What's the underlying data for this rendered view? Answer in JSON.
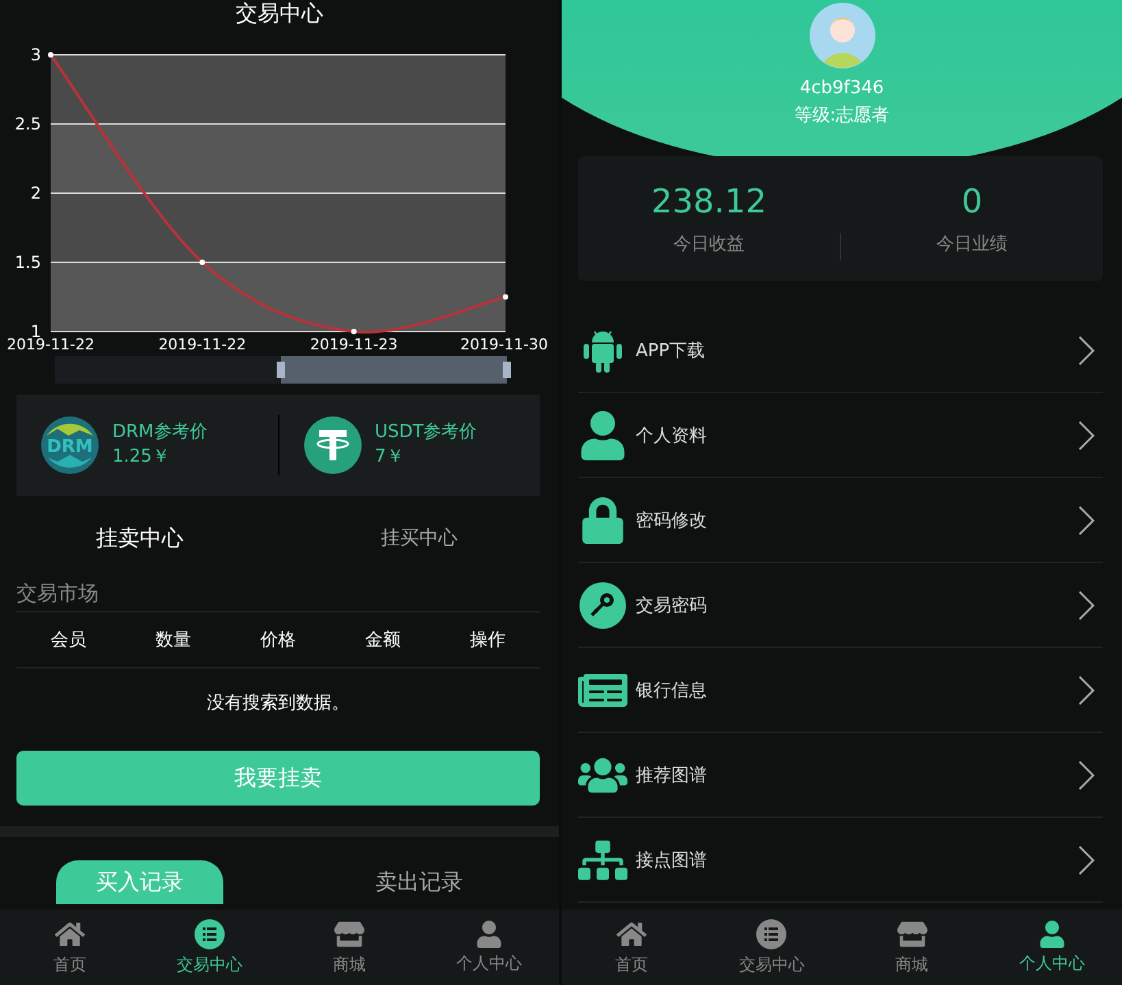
{
  "left": {
    "title": "交易中心",
    "chart_data": {
      "type": "line",
      "categories": [
        "2019-11-22",
        "2019-11-22",
        "2019-11-23",
        "2019-11-30"
      ],
      "grid": true,
      "series": [
        {
          "color": "#b8323a",
          "marker": true,
          "values": [
            3,
            1.5,
            1,
            1.25
          ]
        }
      ],
      "ylim": [
        1,
        3
      ],
      "yticks": [
        {
          "value": 1,
          "label": "1"
        },
        {
          "value": 1.5,
          "label": "1.5"
        },
        {
          "value": 2,
          "label": "2"
        },
        {
          "value": 2.5,
          "label": "2.5"
        },
        {
          "value": 3,
          "label": "3"
        }
      ]
    },
    "prices": [
      {
        "logo_text": "DRM",
        "name": "DRM参考价",
        "value": "1.25￥"
      },
      {
        "name": "USDT参考价",
        "value": "7￥"
      }
    ],
    "tabs": [
      {
        "label": "挂卖中心",
        "selected": true
      },
      {
        "label": "挂买中心",
        "selected": false
      }
    ],
    "market": {
      "title": "交易市场",
      "columns": [
        "会员",
        "数量",
        "价格",
        "金额",
        "操作"
      ],
      "empty": "没有搜索到数据。"
    },
    "button": "我要挂卖",
    "record_tabs": [
      {
        "label": "买入记录",
        "selected": true
      },
      {
        "label": "卖出记录",
        "selected": false
      }
    ],
    "nav": [
      {
        "label": "首页",
        "selected": false
      },
      {
        "label": "交易中心",
        "selected": true
      },
      {
        "label": "商城",
        "selected": false
      },
      {
        "label": "个人中心",
        "selected": false
      }
    ]
  },
  "right": {
    "user": {
      "id": "4cb9f346",
      "level": "等级:志愿者"
    },
    "stats": [
      {
        "value": "238.12",
        "label": "今日收益"
      },
      {
        "value": "0",
        "label": "今日业绩"
      }
    ],
    "menu": [
      {
        "label": "APP下载"
      },
      {
        "label": "个人资料"
      },
      {
        "label": "密码修改"
      },
      {
        "label": "交易密码"
      },
      {
        "label": "银行信息"
      },
      {
        "label": "推荐图谱"
      },
      {
        "label": "接点图谱"
      }
    ],
    "nav": [
      {
        "label": "首页",
        "selected": false
      },
      {
        "label": "交易中心",
        "selected": false
      },
      {
        "label": "商城",
        "selected": false
      },
      {
        "label": "个人中心",
        "selected": true
      }
    ]
  }
}
